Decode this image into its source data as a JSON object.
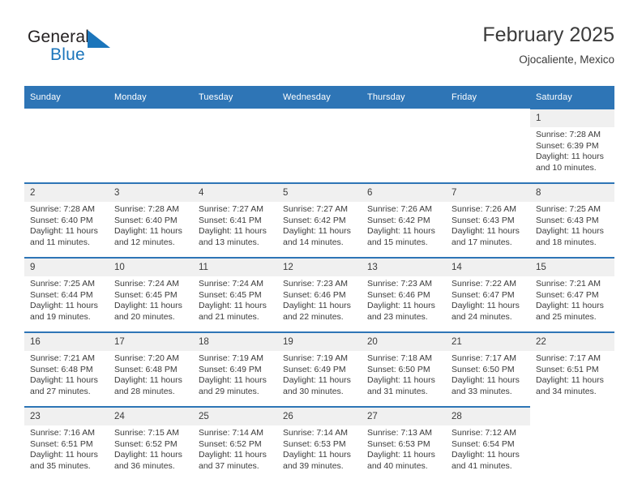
{
  "brand": {
    "name_part1": "General",
    "name_part2": "Blue",
    "flag_icon": "triangle-flag-icon"
  },
  "header": {
    "title": "February 2025",
    "subtitle": "Ojocaliente, Mexico"
  },
  "calendar": {
    "weekday_headers": [
      "Sunday",
      "Monday",
      "Tuesday",
      "Wednesday",
      "Thursday",
      "Friday",
      "Saturday"
    ],
    "accent_color": "#2e75b6",
    "daynum_band_color": "#f0f0f0",
    "weeks": [
      [
        {
          "day": "",
          "lines": []
        },
        {
          "day": "",
          "lines": []
        },
        {
          "day": "",
          "lines": []
        },
        {
          "day": "",
          "lines": []
        },
        {
          "day": "",
          "lines": []
        },
        {
          "day": "",
          "lines": []
        },
        {
          "day": "1",
          "lines": [
            "Sunrise: 7:28 AM",
            "Sunset: 6:39 PM",
            "Daylight: 11 hours",
            "and 10 minutes."
          ]
        }
      ],
      [
        {
          "day": "2",
          "lines": [
            "Sunrise: 7:28 AM",
            "Sunset: 6:40 PM",
            "Daylight: 11 hours",
            "and 11 minutes."
          ]
        },
        {
          "day": "3",
          "lines": [
            "Sunrise: 7:28 AM",
            "Sunset: 6:40 PM",
            "Daylight: 11 hours",
            "and 12 minutes."
          ]
        },
        {
          "day": "4",
          "lines": [
            "Sunrise: 7:27 AM",
            "Sunset: 6:41 PM",
            "Daylight: 11 hours",
            "and 13 minutes."
          ]
        },
        {
          "day": "5",
          "lines": [
            "Sunrise: 7:27 AM",
            "Sunset: 6:42 PM",
            "Daylight: 11 hours",
            "and 14 minutes."
          ]
        },
        {
          "day": "6",
          "lines": [
            "Sunrise: 7:26 AM",
            "Sunset: 6:42 PM",
            "Daylight: 11 hours",
            "and 15 minutes."
          ]
        },
        {
          "day": "7",
          "lines": [
            "Sunrise: 7:26 AM",
            "Sunset: 6:43 PM",
            "Daylight: 11 hours",
            "and 17 minutes."
          ]
        },
        {
          "day": "8",
          "lines": [
            "Sunrise: 7:25 AM",
            "Sunset: 6:43 PM",
            "Daylight: 11 hours",
            "and 18 minutes."
          ]
        }
      ],
      [
        {
          "day": "9",
          "lines": [
            "Sunrise: 7:25 AM",
            "Sunset: 6:44 PM",
            "Daylight: 11 hours",
            "and 19 minutes."
          ]
        },
        {
          "day": "10",
          "lines": [
            "Sunrise: 7:24 AM",
            "Sunset: 6:45 PM",
            "Daylight: 11 hours",
            "and 20 minutes."
          ]
        },
        {
          "day": "11",
          "lines": [
            "Sunrise: 7:24 AM",
            "Sunset: 6:45 PM",
            "Daylight: 11 hours",
            "and 21 minutes."
          ]
        },
        {
          "day": "12",
          "lines": [
            "Sunrise: 7:23 AM",
            "Sunset: 6:46 PM",
            "Daylight: 11 hours",
            "and 22 minutes."
          ]
        },
        {
          "day": "13",
          "lines": [
            "Sunrise: 7:23 AM",
            "Sunset: 6:46 PM",
            "Daylight: 11 hours",
            "and 23 minutes."
          ]
        },
        {
          "day": "14",
          "lines": [
            "Sunrise: 7:22 AM",
            "Sunset: 6:47 PM",
            "Daylight: 11 hours",
            "and 24 minutes."
          ]
        },
        {
          "day": "15",
          "lines": [
            "Sunrise: 7:21 AM",
            "Sunset: 6:47 PM",
            "Daylight: 11 hours",
            "and 25 minutes."
          ]
        }
      ],
      [
        {
          "day": "16",
          "lines": [
            "Sunrise: 7:21 AM",
            "Sunset: 6:48 PM",
            "Daylight: 11 hours",
            "and 27 minutes."
          ]
        },
        {
          "day": "17",
          "lines": [
            "Sunrise: 7:20 AM",
            "Sunset: 6:48 PM",
            "Daylight: 11 hours",
            "and 28 minutes."
          ]
        },
        {
          "day": "18",
          "lines": [
            "Sunrise: 7:19 AM",
            "Sunset: 6:49 PM",
            "Daylight: 11 hours",
            "and 29 minutes."
          ]
        },
        {
          "day": "19",
          "lines": [
            "Sunrise: 7:19 AM",
            "Sunset: 6:49 PM",
            "Daylight: 11 hours",
            "and 30 minutes."
          ]
        },
        {
          "day": "20",
          "lines": [
            "Sunrise: 7:18 AM",
            "Sunset: 6:50 PM",
            "Daylight: 11 hours",
            "and 31 minutes."
          ]
        },
        {
          "day": "21",
          "lines": [
            "Sunrise: 7:17 AM",
            "Sunset: 6:50 PM",
            "Daylight: 11 hours",
            "and 33 minutes."
          ]
        },
        {
          "day": "22",
          "lines": [
            "Sunrise: 7:17 AM",
            "Sunset: 6:51 PM",
            "Daylight: 11 hours",
            "and 34 minutes."
          ]
        }
      ],
      [
        {
          "day": "23",
          "lines": [
            "Sunrise: 7:16 AM",
            "Sunset: 6:51 PM",
            "Daylight: 11 hours",
            "and 35 minutes."
          ]
        },
        {
          "day": "24",
          "lines": [
            "Sunrise: 7:15 AM",
            "Sunset: 6:52 PM",
            "Daylight: 11 hours",
            "and 36 minutes."
          ]
        },
        {
          "day": "25",
          "lines": [
            "Sunrise: 7:14 AM",
            "Sunset: 6:52 PM",
            "Daylight: 11 hours",
            "and 37 minutes."
          ]
        },
        {
          "day": "26",
          "lines": [
            "Sunrise: 7:14 AM",
            "Sunset: 6:53 PM",
            "Daylight: 11 hours",
            "and 39 minutes."
          ]
        },
        {
          "day": "27",
          "lines": [
            "Sunrise: 7:13 AM",
            "Sunset: 6:53 PM",
            "Daylight: 11 hours",
            "and 40 minutes."
          ]
        },
        {
          "day": "28",
          "lines": [
            "Sunrise: 7:12 AM",
            "Sunset: 6:54 PM",
            "Daylight: 11 hours",
            "and 41 minutes."
          ]
        },
        {
          "day": "",
          "lines": []
        }
      ]
    ]
  }
}
